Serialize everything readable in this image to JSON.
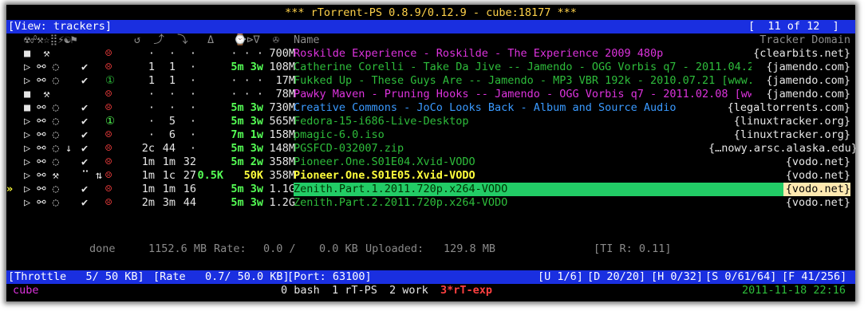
{
  "title": "*** rTorrent-PS 0.8.9/0.12.9 - cube:18177 ***",
  "view": {
    "label": "[View: trackers]",
    "position": "[  11 of 12  ]"
  },
  "header": {
    "icons": "☢☍⚒☆⣿⚡☯⚑",
    "cols": "↺  ⤴  ⤵   Δ   ⌚⊳∇  ✇",
    "name": "Name",
    "tracker_domain": "Tracker Domain"
  },
  "rows": [
    {
      "mark": "",
      "flags": "■  ⚒",
      "check": "",
      "state": "☹",
      "state_color": "c-r",
      "col1": "·",
      "col2": "·",
      "col3": "·",
      "speed": "",
      "rate": "· · ·",
      "size": "700M",
      "name": "Roskilde Experience - Roskilde - The Experience 2009 480p",
      "name_color": "c-m",
      "domain": "{clearbits.net}"
    },
    {
      "mark": "",
      "flags": "▷ ⚯ ◌",
      "check": "✔",
      "state": "☹",
      "state_color": "c-r",
      "col1": "1",
      "col2": "1",
      "col3": "·",
      "speed": "",
      "rate": "5m 3w",
      "size": "108M",
      "name": "Catherine Corelli - Take Da Jive -- Jamendo - OGG Vorbis q7 - 2011.04.29 [",
      "name_color": "c-dg",
      "domain": "{jamendo.com}"
    },
    {
      "mark": "",
      "flags": "▷ ⚯ ◌",
      "check": "✔",
      "state": "①",
      "state_color": "c-dg",
      "col1": "1",
      "col2": "1",
      "col3": "·",
      "speed": "",
      "rate": "· · ·",
      "size": "17M",
      "name": "Fukked Up - These Guys Are -- Jamendo - MP3 VBR 192k - 2010.07.21 [www.jam",
      "name_color": "c-dg",
      "domain": "{jamendo.com}"
    },
    {
      "mark": "",
      "flags": "■  ⚒",
      "check": "",
      "state": "☹",
      "state_color": "c-r",
      "col1": "·",
      "col2": "·",
      "col3": "·",
      "speed": "",
      "rate": "· · ·",
      "size": "78M",
      "name": "Pawky Maven - Pruning Hooks -- Jamendo - OGG Vorbis q7 - 2011.02.08 [www.j",
      "name_color": "c-m",
      "domain": "{jamendo.com}"
    },
    {
      "mark": "",
      "flags": "■ ⚯ ◌",
      "check": "✔",
      "state": "☹",
      "state_color": "c-r",
      "col1": "·",
      "col2": "·",
      "col3": "·",
      "speed": "",
      "rate": "5m 3w",
      "size": "730M",
      "name": "Creative Commons - JoCo Looks Back - Album and Source Audio",
      "name_color": "c-b",
      "domain": "{legaltorrents.com}"
    },
    {
      "mark": "",
      "flags": "▷ ⚯ ◌",
      "check": "✔",
      "state": "①",
      "state_color": "c-g",
      "col1": "·",
      "col2": "5",
      "col3": "·",
      "speed": "",
      "rate": "5m 3w",
      "size": "565M",
      "name": "Fedora-15-i686-Live-Desktop",
      "name_color": "c-dg",
      "domain": "{linuxtracker.org}"
    },
    {
      "mark": "",
      "flags": "▷ ⚯ ◌",
      "check": "✔",
      "state": "☹",
      "state_color": "c-r",
      "col1": "·",
      "col2": "6",
      "col3": "·",
      "speed": "",
      "rate": "7m 1w",
      "size": "158M",
      "name": "pmagic-6.0.iso",
      "name_color": "c-dg",
      "domain": "{linuxtracker.org}"
    },
    {
      "mark": "",
      "flags": "▷ ⚯ ◌ ↓",
      "check": "✔",
      "state": "☹",
      "state_color": "c-r",
      "col1": "2c",
      "col2": "44",
      "col3": "·",
      "speed": "",
      "rate": "5m 3w",
      "size": "148M",
      "name": "PGSFCD-032007.zip",
      "name_color": "c-dg",
      "domain": "{…nowy.arsc.alaska.edu}"
    },
    {
      "mark": "",
      "flags": "▷ ⚯ ◌",
      "check": "✔",
      "state": "☹",
      "state_color": "c-r",
      "col1": "1m",
      "col2": "1m",
      "col3": "32",
      "speed": "",
      "rate": "5m 2w",
      "size": "358M",
      "name": "Pioneer.One.S01E04.Xvid-VODO",
      "name_color": "c-dg",
      "domain": "{vodo.net}"
    },
    {
      "mark": "",
      "flags": "▷ ⚯ ⚒",
      "check": "⠉ ⇅",
      "state": "☹",
      "state_color": "c-r",
      "col1": "1m",
      "col2": "1c",
      "col3": "27",
      "speed": "0.5K",
      "rate": "50K",
      "size": "358M",
      "name": "Pioneer.One.S01E05.Xvid-VODO",
      "name_color": "c-y",
      "domain": "{vodo.net}"
    },
    {
      "mark": "»",
      "flags": "▷ ⚯ ◌",
      "check": "✔",
      "state": "☹",
      "state_color": "c-r",
      "col1": "1m",
      "col2": "1m",
      "col3": "16",
      "speed": "",
      "rate": "5m 3w",
      "size": "1.1G",
      "name": "Zenith.Part.1.2011.720p.x264-VODO",
      "name_color": "sel",
      "domain": "{vodo.net}"
    },
    {
      "mark": "",
      "flags": "▷ ⚯ ◌",
      "check": "✔",
      "state": "☹",
      "state_color": "c-r",
      "col1": "2m",
      "col2": "3m",
      "col3": "44",
      "speed": "",
      "rate": "5m 3w",
      "size": "1.2G",
      "name": "Zenith.Part.2.2011.720p.x264-VODO",
      "name_color": "c-dg",
      "domain": "{vodo.net}"
    }
  ],
  "summary": {
    "done": "done",
    "size": "1152.6 MB",
    "rate_label": "Rate:",
    "rate_up": "0.0 /",
    "rate_down": "0.0 KB",
    "uploaded_label": "Uploaded:",
    "uploaded": "129.8 MB",
    "ti_ratio": "[TI R: 0.11]"
  },
  "statusbar": {
    "throttle": "[Throttle   5/ 50 KB]",
    "rate": "[Rate   0.7/ 50.0 KB]",
    "port": "[Port: 63100]",
    "u": "[U 1/6]",
    "d": "[D 20/20]",
    "h": "[H 0/32]",
    "s": "[S 0/61/64]",
    "f": "[F 41/256]"
  },
  "tmux": {
    "session": "cube",
    "win0": "0 bash",
    "win1": "1 rT-PS",
    "win2": "2 work",
    "win3": "3*rT-exp",
    "datetime": "2011-11-18 22:16"
  },
  "colors": {
    "background": "#000000",
    "bar": "#1a2fe0",
    "selected": "#22cc66",
    "title": "#ffd24a"
  }
}
